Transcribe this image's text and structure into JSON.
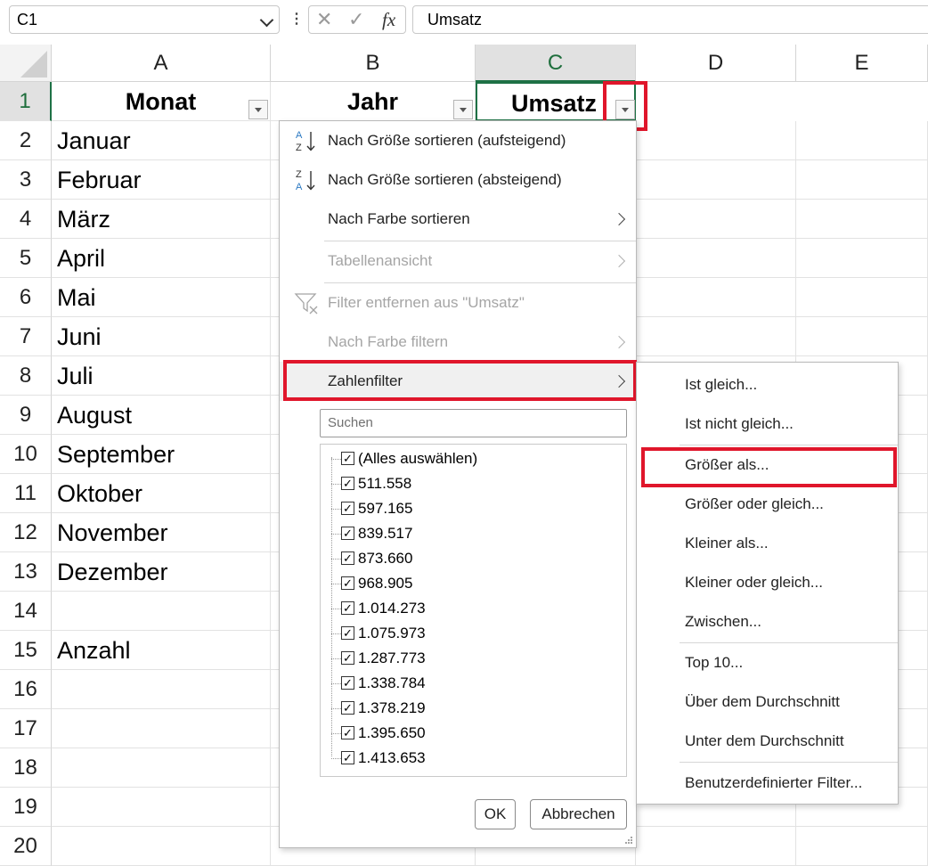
{
  "formula_bar": {
    "name_box": "C1",
    "cancel_icon": "✕",
    "enter_icon": "✓",
    "fx_label": "fx",
    "formula_value": "Umsatz"
  },
  "columns": [
    "A",
    "B",
    "C",
    "D",
    "E"
  ],
  "rows": [
    "1",
    "2",
    "3",
    "4",
    "5",
    "6",
    "7",
    "8",
    "9",
    "10",
    "11",
    "12",
    "13",
    "14",
    "15",
    "16",
    "17",
    "18",
    "19",
    "20"
  ],
  "header_row": {
    "a": "Monat",
    "b": "Jahr",
    "c": "Umsatz"
  },
  "column_a": [
    "Januar",
    "Februar",
    "März",
    "April",
    "Mai",
    "Juni",
    "Juli",
    "August",
    "September",
    "Oktober",
    "November",
    "Dezember",
    "",
    "Anzahl"
  ],
  "menu": {
    "sort_asc": "Nach Größe sortieren (aufsteigend)",
    "sort_desc": "Nach Größe sortieren (absteigend)",
    "sort_color": "Nach Farbe sortieren",
    "table_view": "Tabellenansicht",
    "clear_filter": "Filter entfernen aus \"Umsatz\"",
    "filter_color": "Nach Farbe filtern",
    "number_filter": "Zahlenfilter",
    "search_placeholder": "Suchen",
    "list": [
      "(Alles auswählen)",
      "511.558",
      "597.165",
      "839.517",
      "873.660",
      "968.905",
      "1.014.273",
      "1.075.973",
      "1.287.773",
      "1.338.784",
      "1.378.219",
      "1.395.650",
      "1.413.653"
    ],
    "ok": "OK",
    "cancel": "Abbrechen"
  },
  "submenu": {
    "equals": "Ist gleich...",
    "not_equals": "Ist nicht gleich...",
    "greater": "Größer als...",
    "greater_equal": "Größer oder gleich...",
    "less": "Kleiner als...",
    "less_equal": "Kleiner oder gleich...",
    "between": "Zwischen...",
    "top10": "Top 10...",
    "above_avg": "Über dem Durchschnitt",
    "below_avg": "Unter dem Durchschnitt",
    "custom": "Benutzerdefinierter Filter..."
  },
  "colors": {
    "highlight_red": "#e0162b",
    "selection_green": "#1e7145"
  }
}
